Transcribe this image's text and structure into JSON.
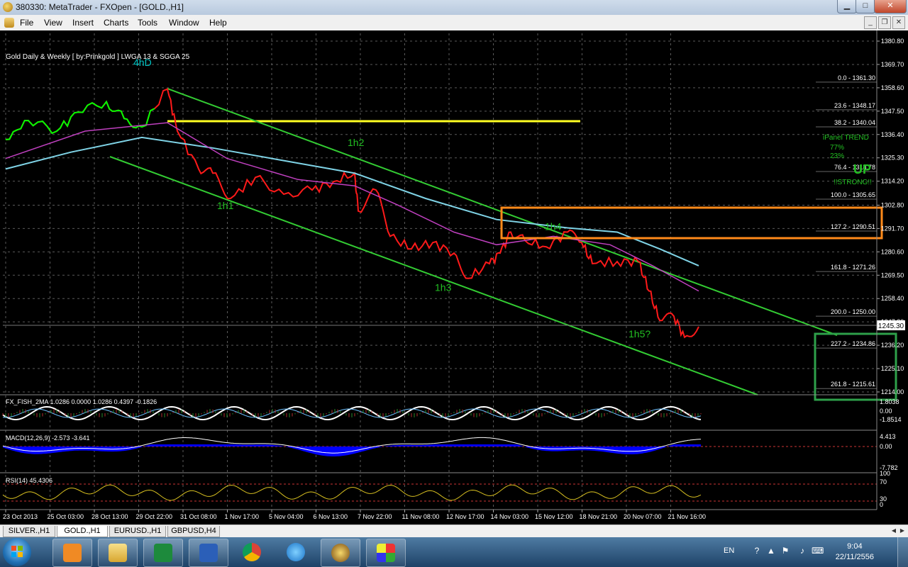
{
  "window": {
    "title": "380330: MetaTrader - FXOpen - [GOLD.,H1]",
    "minimize_glyph": "0",
    "maximize_glyph": "1",
    "close_glyph": "r"
  },
  "menu": {
    "items": [
      "File",
      "View",
      "Insert",
      "Charts",
      "Tools",
      "Window",
      "Help"
    ]
  },
  "chart_data": {
    "type": "line",
    "title": "Gold Daily & Weekly [ by:Prinkgold ] LWGA 13 & SGGA 25",
    "symbol": "GOLD.,H1",
    "current_price": "1245.30",
    "price_axis": {
      "ylim": [
        1214.0,
        1380.8
      ],
      "ticks": [
        "1380.80",
        "1369.70",
        "1358.60",
        "1347.50",
        "1336.40",
        "1325.30",
        "1314.20",
        "1302.80",
        "1291.70",
        "1280.60",
        "1269.50",
        "1258.40",
        "1247.30",
        "1236.20",
        "1225.10",
        "1214.00"
      ]
    },
    "time_axis": {
      "ticks": [
        "23 Oct 2013",
        "25 Oct 03:00",
        "28 Oct 13:00",
        "29 Oct 22:00",
        "31 Oct 08:00",
        "1 Nov 17:00",
        "5 Nov 04:00",
        "6 Nov 13:00",
        "7 Nov 22:00",
        "11 Nov 08:00",
        "12 Nov 17:00",
        "14 Nov 03:00",
        "15 Nov 12:00",
        "18 Nov 21:00",
        "20 Nov 07:00",
        "21 Nov 16:00"
      ]
    },
    "fibonacci_levels": [
      {
        "label": "0.0 - 1361.30",
        "ratio": 0.0,
        "price": 1361.3
      },
      {
        "label": "23.6 - 1348.17",
        "ratio": 23.6,
        "price": 1348.17
      },
      {
        "label": "38.2 - 1340.04",
        "ratio": 38.2,
        "price": 1340.04
      },
      {
        "label": "76.4 - 1318.78",
        "ratio": 76.4,
        "price": 1318.78
      },
      {
        "label": "100.0 - 1305.65",
        "ratio": 100.0,
        "price": 1305.65
      },
      {
        "label": "127.2 - 1290.51",
        "ratio": 127.2,
        "price": 1290.51
      },
      {
        "label": "161.8 - 1271.26",
        "ratio": 161.8,
        "price": 1271.26
      },
      {
        "label": "200.0 - 1250.00",
        "ratio": 200.0,
        "price": 1250.0
      },
      {
        "label": "227.2 - 1234.86",
        "ratio": 227.2,
        "price": 1234.86
      },
      {
        "label": "261.8 - 1215.61",
        "ratio": 261.8,
        "price": 1215.61
      }
    ],
    "wave_labels": [
      {
        "text": "4hD",
        "color": "#00c8c8"
      },
      {
        "text": "1h1",
        "color": "#22c022"
      },
      {
        "text": "1h2",
        "color": "#22c022"
      },
      {
        "text": "1h3",
        "color": "#22c022"
      },
      {
        "text": "1h4",
        "color": "#22c022"
      },
      {
        "text": "1h5?",
        "color": "#22c022"
      }
    ],
    "signal_panel": {
      "lines": [
        "iPanel TREND",
        "77%",
        "23%",
        "UP",
        "!!STRONG!!"
      ],
      "lines_color": "#22c022",
      "up_color": "#22c022"
    },
    "indicators": [
      {
        "name": "FX_FISH_2MA 1.0286 0.0000 1.0286 0.4397 -0.1826",
        "scale": [
          "1.8038",
          "0.00",
          "-1.8514"
        ]
      },
      {
        "name": "MACD(12,26,9) -2.573 -3.641",
        "scale": [
          "4.413",
          "0.00",
          "-7.782"
        ]
      },
      {
        "name": "RSI(14) 45.4306",
        "scale": [
          "100",
          "70",
          "30",
          "0"
        ]
      }
    ],
    "colors": {
      "background": "#000000",
      "grid": "#5a5a5a",
      "candles": "#ff1a1a",
      "candles_up": "#00ff00",
      "channel": "#33cc33",
      "ma_slow": "#7fd3e6",
      "ma_mid": "#c040c0",
      "resistance_line": "#ffff22",
      "target_box_orange": "#ff8a1a",
      "target_box_green": "#2ea04a",
      "macd_hist": "#0000ff",
      "rsi": "#d8c020"
    }
  },
  "tabs": [
    {
      "label": "SILVER.,H1",
      "active": false
    },
    {
      "label": "GOLD.,H1",
      "active": true
    },
    {
      "label": "EURUSD.,H1",
      "active": false
    },
    {
      "label": "GBPUSD,H4",
      "active": false
    }
  ],
  "taskbar": {
    "apps": [
      "media-player",
      "file-explorer",
      "excel",
      "word",
      "chrome",
      "internet-explorer",
      "metatrader",
      "paint"
    ],
    "language": "EN",
    "time": "9:04",
    "date": "22/11/2556"
  }
}
